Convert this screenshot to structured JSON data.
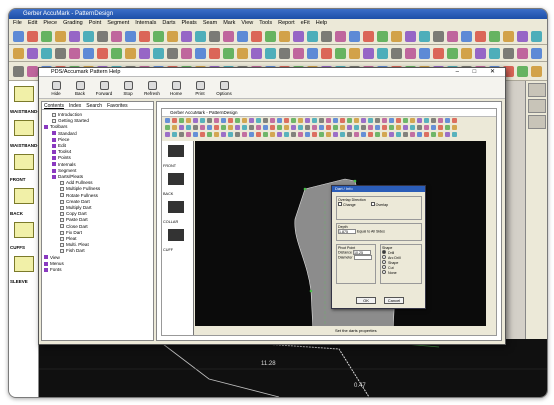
{
  "app": {
    "title": "Gerber AccuMark - PatternDesign",
    "menu": [
      "File",
      "Edit",
      "Piece",
      "Grading",
      "Point",
      "Segment",
      "Internals",
      "Darts",
      "Pleats",
      "Seam",
      "Mark",
      "View",
      "Tools",
      "Report",
      "eFit",
      "Help"
    ]
  },
  "left_pieces": [
    {
      "label": "WAISTBAND-1"
    },
    {
      "label": "WAISTBAND-2"
    },
    {
      "label": "FRONT"
    },
    {
      "label": "BACK"
    },
    {
      "label": "CUFFS"
    },
    {
      "label": "SLEEVE"
    }
  ],
  "help": {
    "title": "PDS/Accumark Pattern Help",
    "controls": "– □ ✕",
    "toolbar": [
      {
        "label": "Hide",
        "icon": "hide-icon"
      },
      {
        "label": "Back",
        "icon": "back-icon"
      },
      {
        "label": "Forward",
        "icon": "forward-icon"
      },
      {
        "label": "Stop",
        "icon": "stop-icon"
      },
      {
        "label": "Refresh",
        "icon": "refresh-icon"
      },
      {
        "label": "Home",
        "icon": "home-icon"
      },
      {
        "label": "Print",
        "icon": "print-icon"
      },
      {
        "label": "Options",
        "icon": "options-icon"
      }
    ],
    "tabs": [
      "Contents",
      "Index",
      "Search",
      "Favorites"
    ],
    "tree": [
      {
        "label": "Introduction",
        "indent": 1,
        "kind": "page"
      },
      {
        "label": "Getting Started",
        "indent": 1,
        "kind": "page"
      },
      {
        "label": "Toolbars",
        "indent": 0,
        "kind": "book"
      },
      {
        "label": "Standard",
        "indent": 1,
        "kind": "book"
      },
      {
        "label": "Piece",
        "indent": 1,
        "kind": "book"
      },
      {
        "label": "Edit",
        "indent": 1,
        "kind": "book"
      },
      {
        "label": "Tools4",
        "indent": 1,
        "kind": "book"
      },
      {
        "label": "Points",
        "indent": 1,
        "kind": "book"
      },
      {
        "label": "Internals",
        "indent": 1,
        "kind": "book"
      },
      {
        "label": "Segment",
        "indent": 1,
        "kind": "book"
      },
      {
        "label": "Darts/Pleats",
        "indent": 1,
        "kind": "book"
      },
      {
        "label": "Add Fullness",
        "indent": 2,
        "kind": "page"
      },
      {
        "label": "Multiple Fullness",
        "indent": 2,
        "kind": "page"
      },
      {
        "label": "Rotate Fullness",
        "indent": 2,
        "kind": "page"
      },
      {
        "label": "Create Dart",
        "indent": 2,
        "kind": "page"
      },
      {
        "label": "Multiply Dart",
        "indent": 2,
        "kind": "page"
      },
      {
        "label": "Copy Dart",
        "indent": 2,
        "kind": "page"
      },
      {
        "label": "Paste Dart",
        "indent": 2,
        "kind": "page"
      },
      {
        "label": "Close Dart",
        "indent": 2,
        "kind": "page"
      },
      {
        "label": "Fix Dart",
        "indent": 2,
        "kind": "page"
      },
      {
        "label": "Pleat",
        "indent": 2,
        "kind": "page"
      },
      {
        "label": "Multi. Pleat",
        "indent": 2,
        "kind": "page"
      },
      {
        "label": "Fish Dart",
        "indent": 2,
        "kind": "page"
      },
      {
        "label": "View",
        "indent": 0,
        "kind": "book"
      },
      {
        "label": "Menus",
        "indent": 0,
        "kind": "book"
      },
      {
        "label": "Fonts",
        "indent": 0,
        "kind": "book"
      }
    ]
  },
  "inner_app": {
    "title": "Gerber AccuMark - PatternDesign",
    "pieces": [
      "FRONT",
      "BACK",
      "COLLAR",
      "CUFF"
    ],
    "status": "Set the darts properties"
  },
  "dialog": {
    "title": "Dart / Info",
    "group_fold": "Overlap Direction",
    "check_overlap": "Overlap",
    "check_change": "Change",
    "depth_label": "Depth",
    "depth_value": "1.875",
    "equal_label": "Equal to All Sides",
    "pivot_label": "Pivot Point",
    "distance_label": "Distance",
    "distance_value": "10.25",
    "diameter_label": "Diameter",
    "shape_label": "Shape",
    "shape_options": [
      "Drill",
      "Arc Drill",
      "Shape",
      "Cut",
      "None"
    ],
    "ok": "OK",
    "cancel": "Cancel"
  },
  "bg_values": [
    "11.28",
    "0.47"
  ],
  "colors": {
    "accent": "#2b5db8",
    "piece_fill": "#f1f0a8",
    "canvas": "#0b0b0b",
    "garment": "#8c8c8c",
    "dart": "#cc3030"
  }
}
